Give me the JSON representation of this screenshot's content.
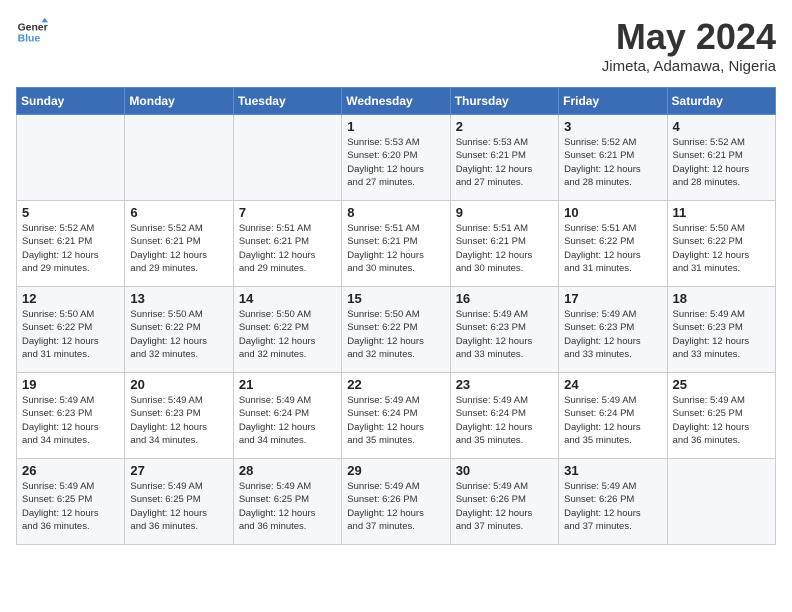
{
  "logo": {
    "line1": "General",
    "line2": "Blue"
  },
  "title": "May 2024",
  "subtitle": "Jimeta, Adamawa, Nigeria",
  "days_of_week": [
    "Sunday",
    "Monday",
    "Tuesday",
    "Wednesday",
    "Thursday",
    "Friday",
    "Saturday"
  ],
  "weeks": [
    [
      {
        "day": "",
        "text": ""
      },
      {
        "day": "",
        "text": ""
      },
      {
        "day": "",
        "text": ""
      },
      {
        "day": "1",
        "text": "Sunrise: 5:53 AM\nSunset: 6:20 PM\nDaylight: 12 hours\nand 27 minutes."
      },
      {
        "day": "2",
        "text": "Sunrise: 5:53 AM\nSunset: 6:21 PM\nDaylight: 12 hours\nand 27 minutes."
      },
      {
        "day": "3",
        "text": "Sunrise: 5:52 AM\nSunset: 6:21 PM\nDaylight: 12 hours\nand 28 minutes."
      },
      {
        "day": "4",
        "text": "Sunrise: 5:52 AM\nSunset: 6:21 PM\nDaylight: 12 hours\nand 28 minutes."
      }
    ],
    [
      {
        "day": "5",
        "text": "Sunrise: 5:52 AM\nSunset: 6:21 PM\nDaylight: 12 hours\nand 29 minutes."
      },
      {
        "day": "6",
        "text": "Sunrise: 5:52 AM\nSunset: 6:21 PM\nDaylight: 12 hours\nand 29 minutes."
      },
      {
        "day": "7",
        "text": "Sunrise: 5:51 AM\nSunset: 6:21 PM\nDaylight: 12 hours\nand 29 minutes."
      },
      {
        "day": "8",
        "text": "Sunrise: 5:51 AM\nSunset: 6:21 PM\nDaylight: 12 hours\nand 30 minutes."
      },
      {
        "day": "9",
        "text": "Sunrise: 5:51 AM\nSunset: 6:21 PM\nDaylight: 12 hours\nand 30 minutes."
      },
      {
        "day": "10",
        "text": "Sunrise: 5:51 AM\nSunset: 6:22 PM\nDaylight: 12 hours\nand 31 minutes."
      },
      {
        "day": "11",
        "text": "Sunrise: 5:50 AM\nSunset: 6:22 PM\nDaylight: 12 hours\nand 31 minutes."
      }
    ],
    [
      {
        "day": "12",
        "text": "Sunrise: 5:50 AM\nSunset: 6:22 PM\nDaylight: 12 hours\nand 31 minutes."
      },
      {
        "day": "13",
        "text": "Sunrise: 5:50 AM\nSunset: 6:22 PM\nDaylight: 12 hours\nand 32 minutes."
      },
      {
        "day": "14",
        "text": "Sunrise: 5:50 AM\nSunset: 6:22 PM\nDaylight: 12 hours\nand 32 minutes."
      },
      {
        "day": "15",
        "text": "Sunrise: 5:50 AM\nSunset: 6:22 PM\nDaylight: 12 hours\nand 32 minutes."
      },
      {
        "day": "16",
        "text": "Sunrise: 5:49 AM\nSunset: 6:23 PM\nDaylight: 12 hours\nand 33 minutes."
      },
      {
        "day": "17",
        "text": "Sunrise: 5:49 AM\nSunset: 6:23 PM\nDaylight: 12 hours\nand 33 minutes."
      },
      {
        "day": "18",
        "text": "Sunrise: 5:49 AM\nSunset: 6:23 PM\nDaylight: 12 hours\nand 33 minutes."
      }
    ],
    [
      {
        "day": "19",
        "text": "Sunrise: 5:49 AM\nSunset: 6:23 PM\nDaylight: 12 hours\nand 34 minutes."
      },
      {
        "day": "20",
        "text": "Sunrise: 5:49 AM\nSunset: 6:23 PM\nDaylight: 12 hours\nand 34 minutes."
      },
      {
        "day": "21",
        "text": "Sunrise: 5:49 AM\nSunset: 6:24 PM\nDaylight: 12 hours\nand 34 minutes."
      },
      {
        "day": "22",
        "text": "Sunrise: 5:49 AM\nSunset: 6:24 PM\nDaylight: 12 hours\nand 35 minutes."
      },
      {
        "day": "23",
        "text": "Sunrise: 5:49 AM\nSunset: 6:24 PM\nDaylight: 12 hours\nand 35 minutes."
      },
      {
        "day": "24",
        "text": "Sunrise: 5:49 AM\nSunset: 6:24 PM\nDaylight: 12 hours\nand 35 minutes."
      },
      {
        "day": "25",
        "text": "Sunrise: 5:49 AM\nSunset: 6:25 PM\nDaylight: 12 hours\nand 36 minutes."
      }
    ],
    [
      {
        "day": "26",
        "text": "Sunrise: 5:49 AM\nSunset: 6:25 PM\nDaylight: 12 hours\nand 36 minutes."
      },
      {
        "day": "27",
        "text": "Sunrise: 5:49 AM\nSunset: 6:25 PM\nDaylight: 12 hours\nand 36 minutes."
      },
      {
        "day": "28",
        "text": "Sunrise: 5:49 AM\nSunset: 6:25 PM\nDaylight: 12 hours\nand 36 minutes."
      },
      {
        "day": "29",
        "text": "Sunrise: 5:49 AM\nSunset: 6:26 PM\nDaylight: 12 hours\nand 37 minutes."
      },
      {
        "day": "30",
        "text": "Sunrise: 5:49 AM\nSunset: 6:26 PM\nDaylight: 12 hours\nand 37 minutes."
      },
      {
        "day": "31",
        "text": "Sunrise: 5:49 AM\nSunset: 6:26 PM\nDaylight: 12 hours\nand 37 minutes."
      },
      {
        "day": "",
        "text": ""
      }
    ]
  ]
}
